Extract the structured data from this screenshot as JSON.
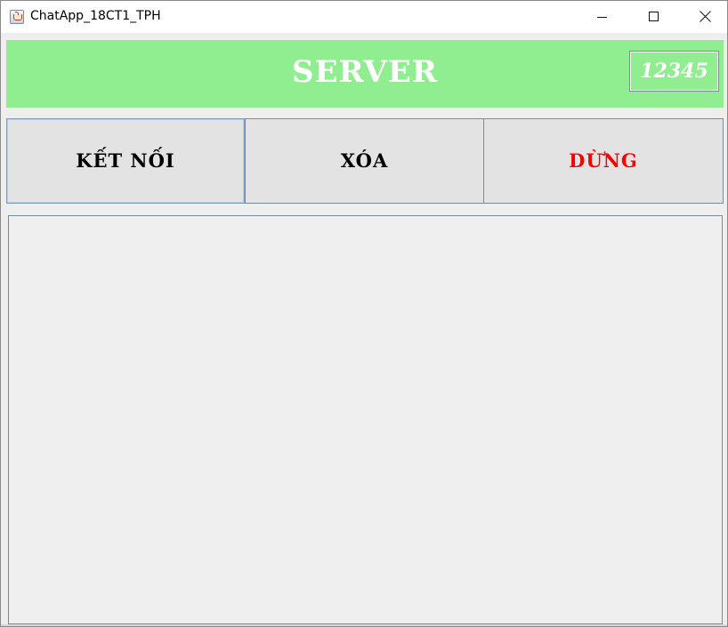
{
  "window": {
    "title": "ChatApp_18CT1_TPH",
    "icon": "java-cup-icon",
    "controls": {
      "minimize_icon": "minimize-icon",
      "maximize_icon": "maximize-icon",
      "close_icon": "close-icon"
    }
  },
  "header": {
    "title": "SERVER",
    "port_value": "12345",
    "background_color": "#90ee90",
    "title_color": "#ffffff"
  },
  "buttons": {
    "connect_label": "KẾT NỐI",
    "clear_label": "XÓA",
    "stop_label": "DỪNG",
    "stop_color": "#ff0000"
  },
  "log": {
    "value": ""
  }
}
